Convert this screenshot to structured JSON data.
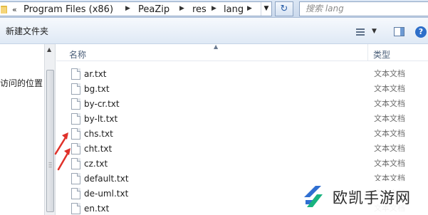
{
  "address_bar": {
    "back_glyph": "«",
    "crumbs": [
      "Program Files (x86)",
      "PeaZip",
      "res",
      "lang"
    ],
    "search_placeholder": "搜索 lang",
    "refresh_icon": "refresh-icon"
  },
  "toolbar": {
    "new_folder_label": "新建文件夹",
    "help_glyph": "?"
  },
  "nav": {
    "recent_label": "访问的位置"
  },
  "list": {
    "col_name": "名称",
    "col_type": "类型",
    "files": [
      {
        "name": "ar.txt",
        "type": "文本文档"
      },
      {
        "name": "bg.txt",
        "type": "文本文档"
      },
      {
        "name": "by-cr.txt",
        "type": "文本文档"
      },
      {
        "name": "by-lt.txt",
        "type": "文本文档"
      },
      {
        "name": "chs.txt",
        "type": "文本文档"
      },
      {
        "name": "cht.txt",
        "type": "文本文档"
      },
      {
        "name": "cz.txt",
        "type": "文本文档"
      },
      {
        "name": "default.txt",
        "type": "文本文档"
      },
      {
        "name": "de-uml.txt",
        "type": "文本文档"
      },
      {
        "name": "en.txt",
        "type": "文本文档"
      }
    ]
  },
  "annotations": {
    "arrow_color": "#e0312a",
    "arrow_targets": [
      "chs.txt",
      "cht.txt"
    ]
  },
  "watermark": {
    "text": "欧凯手游网",
    "logo_colors": [
      "#2f6fd1",
      "#19b37f"
    ]
  }
}
